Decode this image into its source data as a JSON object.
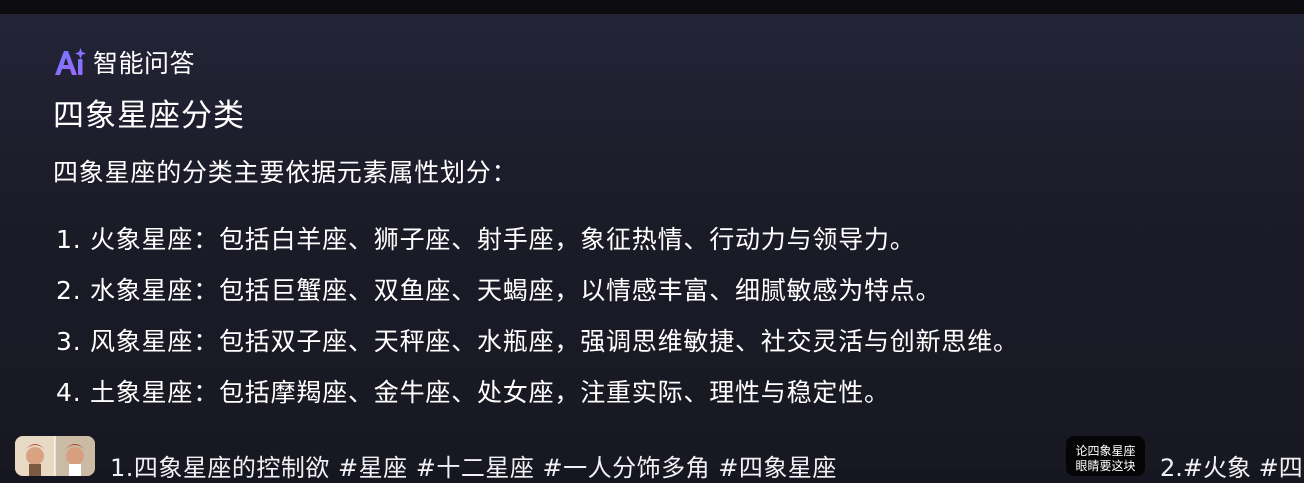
{
  "header": {
    "icon": "ai-sparkle-icon",
    "label": "智能问答"
  },
  "answer": {
    "title": "四象星座分类",
    "intro": "四象星座的分类主要依据元素属性划分：",
    "items": [
      {
        "num": "1.",
        "text": "火象星座：包括白羊座、狮子座、射手座，象征热情、行动力与领导力。"
      },
      {
        "num": "2.",
        "text": "水象星座：包括巨蟹座、双鱼座、天蝎座，以情感丰富、细腻敏感为特点。"
      },
      {
        "num": "3.",
        "text": "风象星座：包括双子座、天秤座、水瓶座，强调思维敏捷、社交灵活与创新思维。"
      },
      {
        "num": "4.",
        "text": "土象星座：包括摩羯座、金牛座、处女座，注重实际、理性与稳定性。"
      }
    ]
  },
  "related": [
    {
      "text": "1.四象星座的控制欲 #星座 #十二星座 #一人分饰多角 #四象星座"
    },
    {
      "thumb_lines": [
        "论四象星座",
        "眼睛要这块"
      ],
      "text": "2.#火象 #四"
    }
  ],
  "colors": {
    "background": "#161620",
    "accent_gradient": [
      "#6f7cff",
      "#a066ff"
    ]
  }
}
